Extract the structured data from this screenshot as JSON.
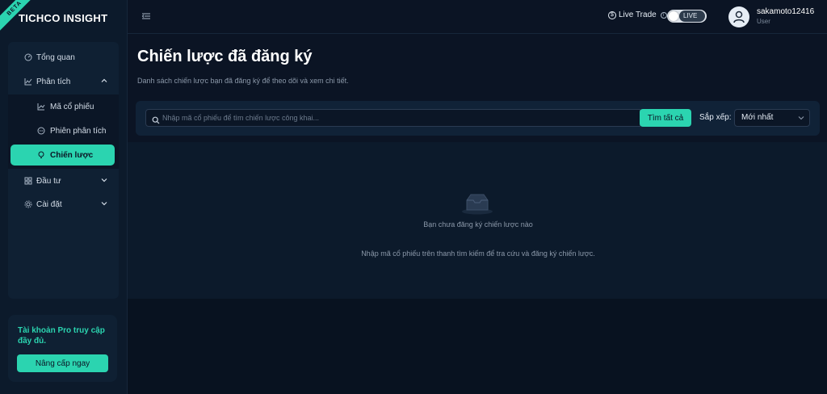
{
  "brand": {
    "name": "TICHCO INSIGHT",
    "badge": "BETA"
  },
  "sidebar": {
    "items": [
      {
        "label": "Tổng quan",
        "icon": "dashboard-icon"
      },
      {
        "label": "Phân tích",
        "icon": "chart-icon",
        "expanded": true
      },
      {
        "label": "Mã cổ phiếu",
        "icon": "trend-icon"
      },
      {
        "label": "Phiên phân tích",
        "icon": "chat-icon"
      },
      {
        "label": "Chiến lược",
        "icon": "lightbulb-icon",
        "active": true
      },
      {
        "label": "Đầu tư",
        "icon": "grid-icon"
      },
      {
        "label": "Cài đặt",
        "icon": "gear-icon"
      }
    ],
    "pro": {
      "text": "Tài khoản Pro truy cập đầy đủ.",
      "button": "Nâng cấp ngay"
    }
  },
  "header": {
    "live_trade_label": "Live Trade",
    "live_toggle_text": "LIVE",
    "user_name": "sakamoto12416",
    "user_role": "User"
  },
  "main": {
    "title": "Chiến lược đã đăng ký",
    "subtitle": "Danh sách chiến lược bạn đã đăng ký để theo dõi và xem chi tiết.",
    "search": {
      "placeholder": "Nhập mã cổ phiếu để tìm chiến lược công khai...",
      "value": "",
      "button": "Tìm tất cả"
    },
    "sort": {
      "label": "Sắp xếp:",
      "selected": "Mới nhất"
    },
    "empty": {
      "title": "Bạn chưa đăng ký chiến lược nào",
      "hint": "Nhập mã cổ phiếu trên thanh tìm kiếm để tra cứu và đăng ký chiến lược."
    }
  },
  "colors": {
    "accent": "#2bd4b0",
    "background": "#0b1424",
    "panel": "#0f2033"
  }
}
